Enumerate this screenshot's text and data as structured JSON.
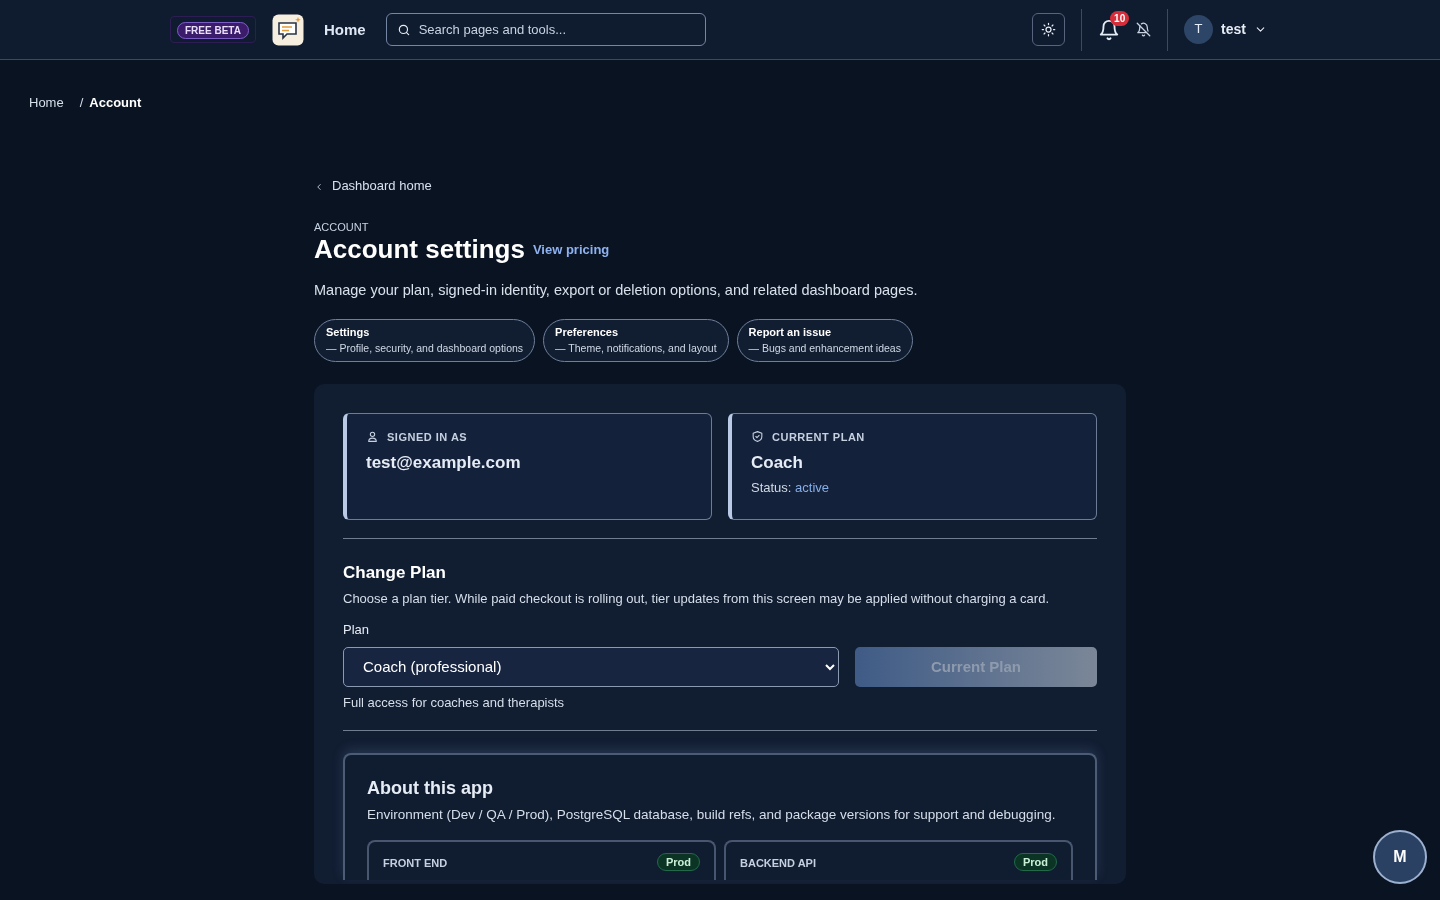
{
  "header": {
    "beta_badge": "FREE BETA",
    "home_link": "Home",
    "search": {
      "placeholder": "Search pages and tools..."
    },
    "notifications": {
      "count": "10"
    },
    "user": {
      "initial": "T",
      "name": "test"
    }
  },
  "breadcrumb": {
    "separator": "/",
    "items": [
      {
        "label": "Home",
        "current": false
      },
      {
        "label": "Account",
        "current": true
      }
    ]
  },
  "back_link": "Dashboard home",
  "eyebrow": "ACCOUNT",
  "title": "Account settings",
  "pricing_link": "View pricing",
  "description": "Manage your plan, signed-in identity, export or deletion options, and related dashboard pages.",
  "quick_links": [
    {
      "title": "Settings",
      "subtitle": "— Profile, security, and dashboard options"
    },
    {
      "title": "Preferences",
      "subtitle": "— Theme, notifications, and layout"
    },
    {
      "title": "Report an issue",
      "subtitle": "— Bugs and enhancement ideas"
    }
  ],
  "info_cards": [
    {
      "kind": "identity",
      "label": "SIGNED IN AS",
      "value": "test@example.com"
    },
    {
      "kind": "plan",
      "label": "CURRENT PLAN",
      "value": "Coach",
      "status_label": "Status:",
      "status": "active"
    }
  ],
  "change_plan": {
    "title": "Change Plan",
    "description": "Choose a plan tier. While paid checkout is rolling out, tier updates from this screen may be applied without charging a card.",
    "plan_label": "Plan",
    "plan_value": "Coach (professional)",
    "button": {
      "label": "Current Plan",
      "disabled": true
    },
    "hint": "Full access for coaches and therapists"
  },
  "about": {
    "title": "About this app",
    "description": "Environment (Dev / QA / Prod), PostgreSQL database, build refs, and package versions for support and debugging.",
    "environments": [
      {
        "name": "FRONT END",
        "badge": "Prod"
      },
      {
        "name": "BACKEND API",
        "badge": "Prod"
      }
    ]
  },
  "fab": "M"
}
